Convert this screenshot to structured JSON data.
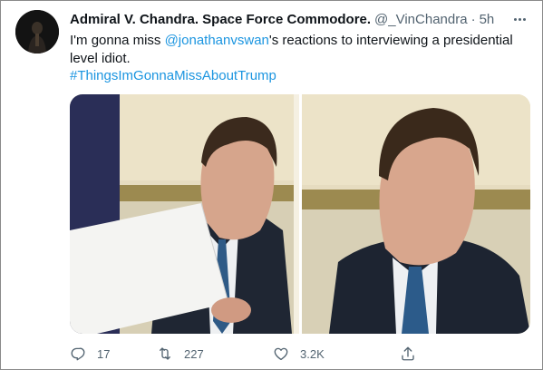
{
  "author": {
    "display_name": "Admiral V. Chandra. Space Force Commodore.",
    "handle": "@_VinChandra",
    "separator": "·",
    "timestamp": "5h"
  },
  "body": {
    "text_before": "I'm gonna miss ",
    "mention": "@jonathanvswan",
    "text_after": "'s reactions to interviewing a presidential level idiot.",
    "hashtag": "#ThingsImGonnaMissAboutTrump"
  },
  "actions": {
    "reply_count": "17",
    "retweet_count": "227",
    "like_count": "3.2K"
  },
  "icons": {
    "more": "more-horizontal-icon",
    "reply": "reply-icon",
    "retweet": "retweet-icon",
    "like": "heart-icon",
    "share": "share-icon"
  },
  "colors": {
    "link": "#1b95e0",
    "secondary": "#536471",
    "primary": "#0f1419"
  }
}
